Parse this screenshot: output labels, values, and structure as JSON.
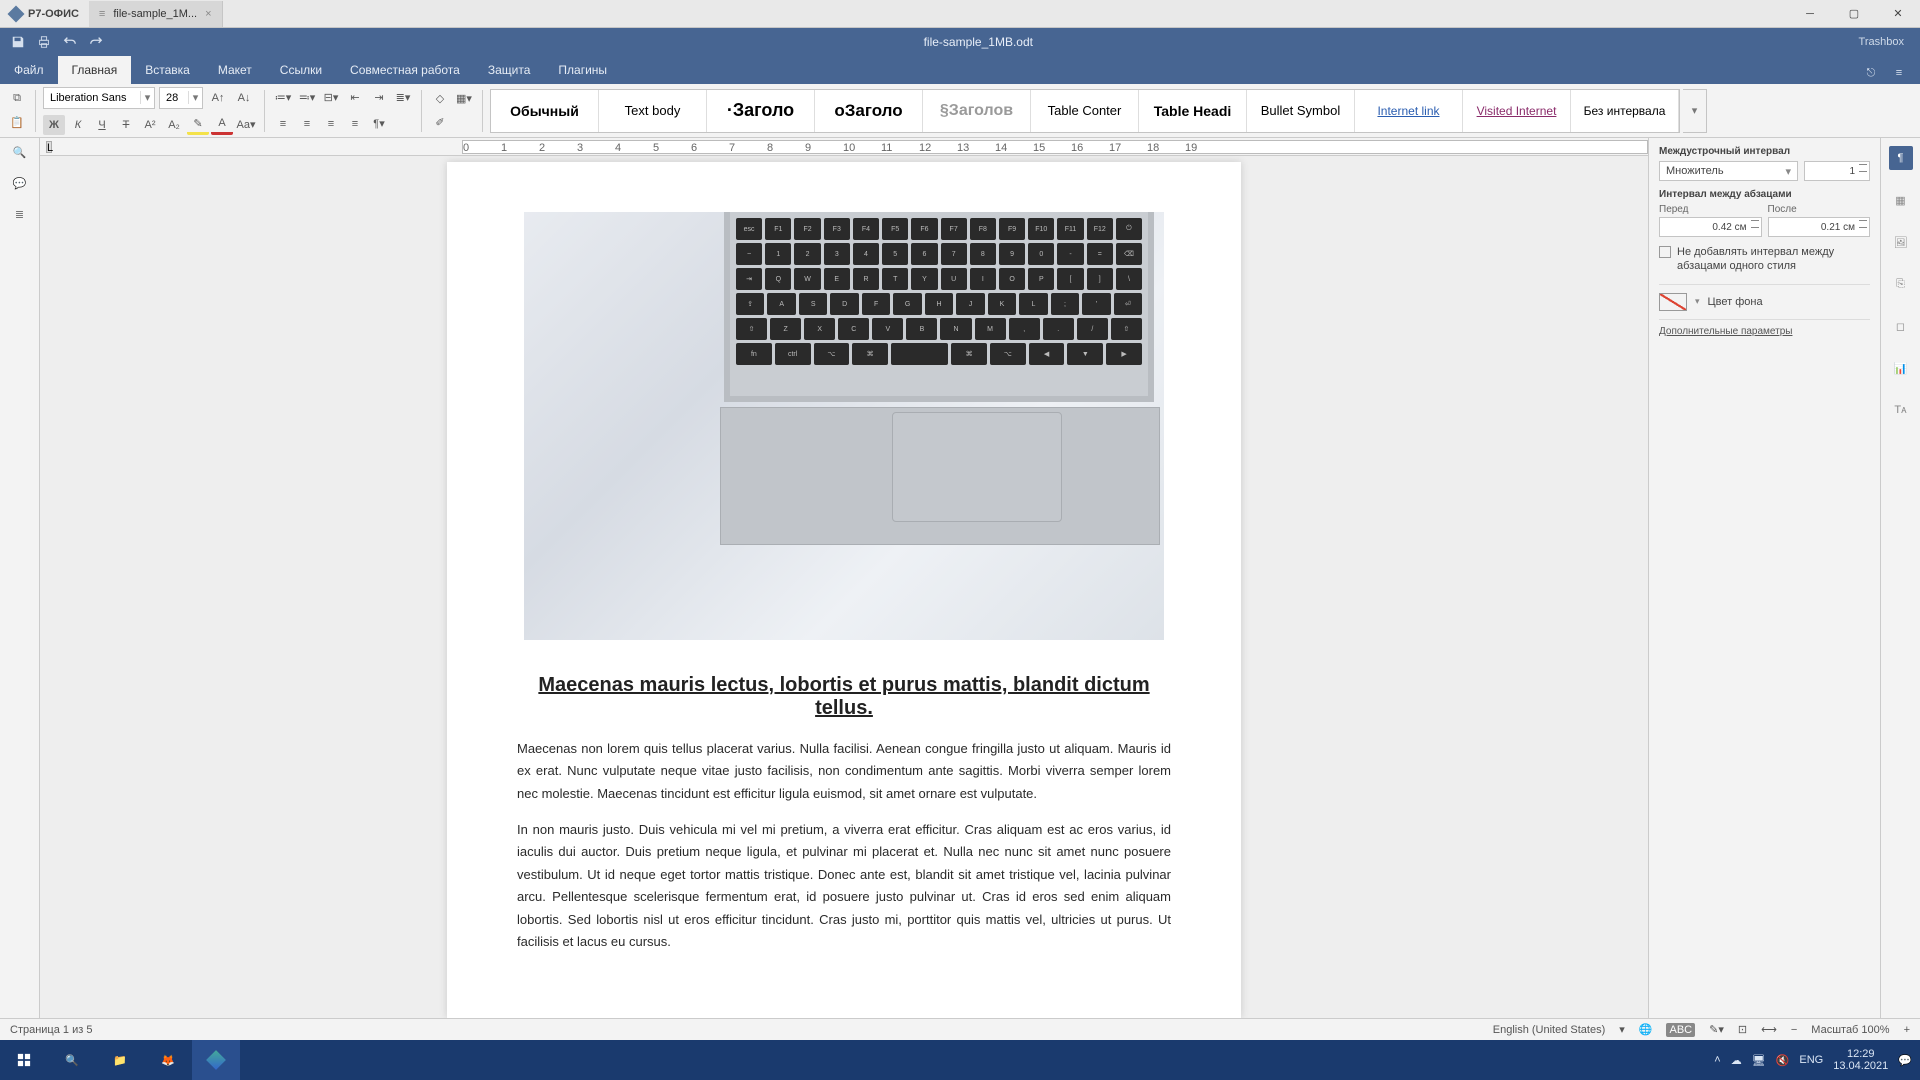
{
  "app": {
    "name": "Р7-ОФИС",
    "tab": "file-sample_1M...",
    "filename": "file-sample_1MB.odt",
    "topright": "Trashbox"
  },
  "menu": [
    "Файл",
    "Главная",
    "Вставка",
    "Макет",
    "Ссылки",
    "Совместная работа",
    "Защита",
    "Плагины"
  ],
  "font": {
    "family": "Liberation Sans",
    "size": "28"
  },
  "styles": [
    {
      "t": "Обычный",
      "css": "font-weight:700;font-size:14px"
    },
    {
      "t": "Text body",
      "css": "font-size:13px"
    },
    {
      "t": "·Заголо",
      "css": "font-weight:700;font-size:18px"
    },
    {
      "t": "оЗаголо",
      "css": "font-weight:700;font-size:17px"
    },
    {
      "t": "§Заголов",
      "css": "font-weight:700;font-size:16px;color:#9a9a9a"
    },
    {
      "t": "Table Conter",
      "css": "font-size:13px"
    },
    {
      "t": "Table Headi",
      "css": "font-weight:700;font-size:14px"
    },
    {
      "t": "Bullet Symbol",
      "css": "font-size:13px"
    },
    {
      "t": "Internet link",
      "css": "font-size:12px;color:#2a5db0;text-decoration:underline"
    },
    {
      "t": "Visited Internet",
      "css": "font-size:12px;color:#8a2b6a;text-decoration:underline"
    },
    {
      "t": "Без интервала",
      "css": "font-size:12px"
    }
  ],
  "rp": {
    "lh_label": "Междустрочный интервал",
    "lh_mode": "Множитель",
    "lh_val": "1",
    "sp_label": "Интервал между абзацами",
    "before": "Перед",
    "before_v": "0.42 см",
    "after": "После",
    "after_v": "0.21 см",
    "chk": "Не добавлять интервал между абзацами одного стиля",
    "bg": "Цвет фона",
    "more": "Дополнительные параметры"
  },
  "doc": {
    "heading": "Maecenas mauris lectus, lobortis et purus mattis, blandit dictum tellus.",
    "p1": "Maecenas non lorem quis tellus placerat varius. Nulla facilisi. Aenean congue fringilla justo ut aliquam. Mauris id ex erat. Nunc vulputate neque vitae justo facilisis, non condimentum ante sagittis. Morbi viverra semper lorem nec molestie. Maecenas tincidunt est efficitur ligula euismod, sit amet ornare est vulputate.",
    "p2": "In non mauris justo. Duis vehicula mi vel mi pretium, a viverra erat efficitur. Cras aliquam est ac eros varius, id iaculis dui auctor. Duis pretium neque ligula, et pulvinar mi placerat et. Nulla nec nunc sit amet nunc posuere vestibulum. Ut id neque eget tortor mattis tristique. Donec ante est, blandit sit amet tristique vel, lacinia pulvinar arcu. Pellentesque scelerisque fermentum erat, id posuere justo pulvinar ut. Cras id eros sed enim aliquam lobortis. Sed lobortis nisl ut eros efficitur tincidunt. Cras justo mi, porttitor quis mattis vel, ultricies ut purus. Ut facilisis et lacus eu cursus."
  },
  "status": {
    "page": "Страница 1 из 5",
    "lang": "English (United States)",
    "zoom": "Масштаб 100%"
  },
  "tb": {
    "lang": "ENG",
    "time": "12:29",
    "date": "13.04.2021"
  }
}
